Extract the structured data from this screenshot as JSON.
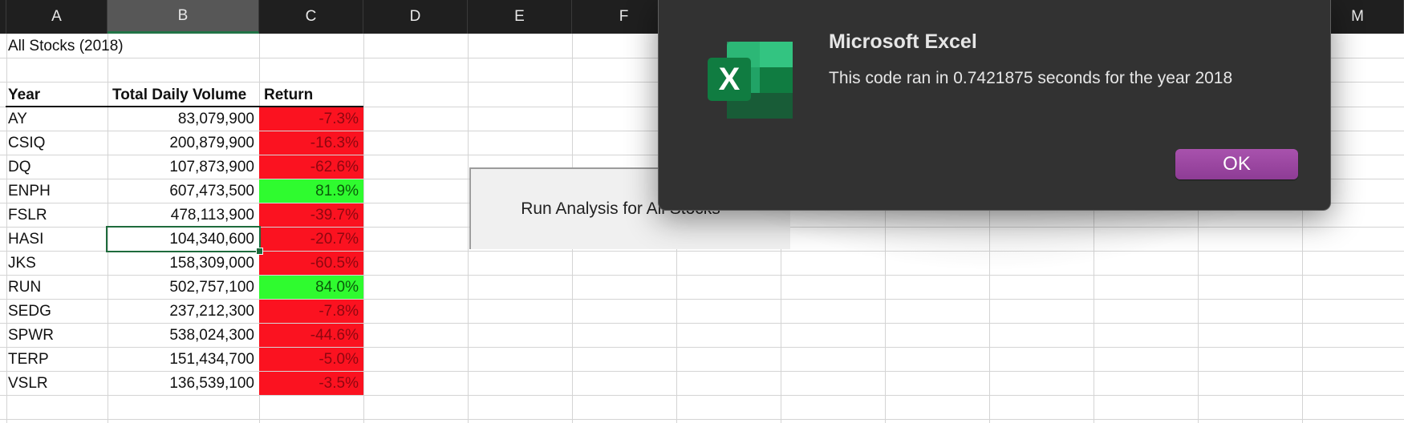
{
  "columns": {
    "A": "A",
    "B": "B",
    "C": "C",
    "D": "D",
    "E": "E",
    "F": "F",
    "M": "M"
  },
  "sheet": {
    "title": "All Stocks (2018)",
    "headers": {
      "ticker": "Year",
      "volume": "Total Daily Volume",
      "ret": "Return"
    },
    "rows": [
      {
        "ticker": "AY",
        "volume": "83,079,900",
        "ret": "-7.3%",
        "status": "neg"
      },
      {
        "ticker": "CSIQ",
        "volume": "200,879,900",
        "ret": "-16.3%",
        "status": "neg"
      },
      {
        "ticker": "DQ",
        "volume": "107,873,900",
        "ret": "-62.6%",
        "status": "neg"
      },
      {
        "ticker": "ENPH",
        "volume": "607,473,500",
        "ret": "81.9%",
        "status": "pos"
      },
      {
        "ticker": "FSLR",
        "volume": "478,113,900",
        "ret": "-39.7%",
        "status": "neg"
      },
      {
        "ticker": "HASI",
        "volume": "104,340,600",
        "ret": "-20.7%",
        "status": "neg"
      },
      {
        "ticker": "JKS",
        "volume": "158,309,000",
        "ret": "-60.5%",
        "status": "neg"
      },
      {
        "ticker": "RUN",
        "volume": "502,757,100",
        "ret": "84.0%",
        "status": "pos"
      },
      {
        "ticker": "SEDG",
        "volume": "237,212,300",
        "ret": "-7.8%",
        "status": "neg"
      },
      {
        "ticker": "SPWR",
        "volume": "538,024,300",
        "ret": "-44.6%",
        "status": "neg"
      },
      {
        "ticker": "TERP",
        "volume": "151,434,700",
        "ret": "-5.0%",
        "status": "neg"
      },
      {
        "ticker": "VSLR",
        "volume": "136,539,100",
        "ret": "-3.5%",
        "status": "neg"
      }
    ]
  },
  "run_button": {
    "label": "Run Analysis for All Stocks"
  },
  "dialog": {
    "title": "Microsoft Excel",
    "message": "This code ran in 0.7421875 seconds for the year 2018",
    "ok_label": "OK",
    "icon": "excel-icon"
  },
  "colors": {
    "negative_fill": "#fb1220",
    "positive_fill": "#2ffb2f",
    "ok_button": "#9b47a1",
    "excel_green": "#217346"
  }
}
